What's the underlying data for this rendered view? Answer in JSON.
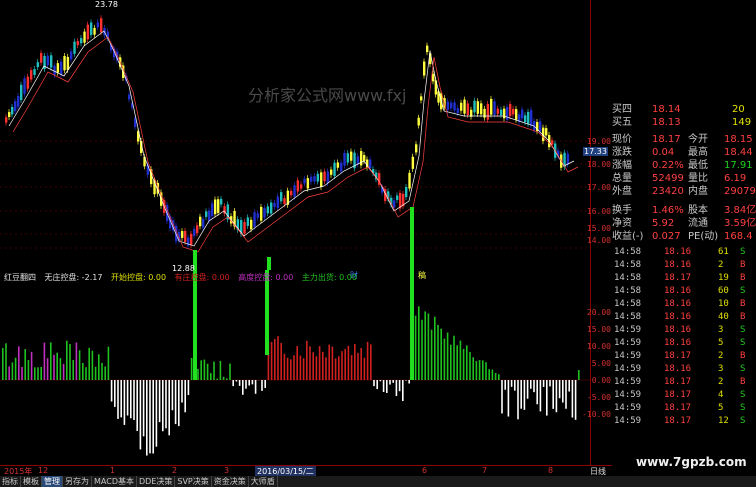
{
  "main_chart": {
    "high_label": "23.78",
    "low_label": "12.88",
    "watermark": "分析家公式网www.fxj",
    "price_axis": [
      "19.00",
      "18.00",
      "17.00",
      "16.00",
      "15.00",
      "14.00"
    ],
    "current_price_tag": "17.33",
    "events": [
      "财",
      "稿"
    ]
  },
  "indicator": {
    "name": "红豆翻四",
    "params": [
      {
        "label": "无庄控盘: -2.17",
        "color": "#e0e0e0"
      },
      {
        "label": "开始控盘: 0.00",
        "color": "#e0e000"
      },
      {
        "label": "有庄控盘: 0.00",
        "color": "#d02020"
      },
      {
        "label": "高度控盘: 0.00",
        "color": "#c030c0"
      },
      {
        "label": "主力出货: 0.00",
        "color": "#20c020"
      }
    ],
    "axis": [
      "20.00",
      "15.00",
      "10.00",
      "5.00",
      "0.00",
      "-5.00",
      "-10.00"
    ]
  },
  "date_axis": [
    "2015年",
    "12",
    "1",
    "2",
    "3",
    "2016/03/15/二",
    "6",
    "7",
    "8",
    "日线"
  ],
  "quote_panel": {
    "rows": [
      {
        "l": "买四",
        "v": "18.14",
        "r": "20"
      },
      {
        "l": "买五",
        "v": "18.13",
        "r": "149"
      },
      {
        "l": "现价",
        "v": "18.17",
        "l2": "今开",
        "v2": "18.15"
      },
      {
        "l": "涨跌",
        "v": "0.04",
        "l2": "最高",
        "v2": "18.44"
      },
      {
        "l": "涨幅",
        "v": "0.22%",
        "l2": "最低",
        "v2": "17.91"
      },
      {
        "l": "总量",
        "v": "52499",
        "l2": "量比",
        "v2": "6.19"
      },
      {
        "l": "外盘",
        "v": "23420",
        "l2": "内盘",
        "v2": "29079"
      },
      {
        "l": "换手",
        "v": "1.46%",
        "l2": "股本",
        "v2": "3.84亿"
      },
      {
        "l": "净资",
        "v": "5.92",
        "l2": "流通",
        "v2": "3.59亿"
      },
      {
        "l": "收益(-)",
        "v": "0.027",
        "l2": "PE(动)",
        "v2": "168.4"
      }
    ],
    "ticks": [
      {
        "t": "14:58",
        "p": "18.16",
        "n": "61",
        "d": "S"
      },
      {
        "t": "14:58",
        "p": "18.16",
        "n": "2",
        "d": "B"
      },
      {
        "t": "14:58",
        "p": "18.17",
        "n": "19",
        "d": "B"
      },
      {
        "t": "14:58",
        "p": "18.16",
        "n": "60",
        "d": "S"
      },
      {
        "t": "14:58",
        "p": "18.16",
        "n": "10",
        "d": "B"
      },
      {
        "t": "14:58",
        "p": "18.16",
        "n": "40",
        "d": "B"
      },
      {
        "t": "14:59",
        "p": "18.16",
        "n": "3",
        "d": "S"
      },
      {
        "t": "14:59",
        "p": "18.16",
        "n": "5",
        "d": "S"
      },
      {
        "t": "14:59",
        "p": "18.17",
        "n": "2",
        "d": "B"
      },
      {
        "t": "14:59",
        "p": "18.16",
        "n": "3",
        "d": "S"
      },
      {
        "t": "14:59",
        "p": "18.17",
        "n": "2",
        "d": "B"
      },
      {
        "t": "14:59",
        "p": "18.17",
        "n": "4",
        "d": "S"
      },
      {
        "t": "14:59",
        "p": "18.17",
        "n": "5",
        "d": "S"
      },
      {
        "t": "14:59",
        "p": "18.17",
        "n": "12",
        "d": "S"
      }
    ]
  },
  "tabs": [
    "指标",
    "模板",
    "管理",
    "另存为",
    "MACD基本",
    "DDE决策",
    "SVP决策",
    "资金决策",
    "大师盾"
  ],
  "site": "www.7gpzb.com",
  "colors": {
    "up": "#ff3030",
    "down": "#20c020",
    "yellow": "#ffff40",
    "blue": "#2020d0",
    "axis": "#8b0000"
  }
}
